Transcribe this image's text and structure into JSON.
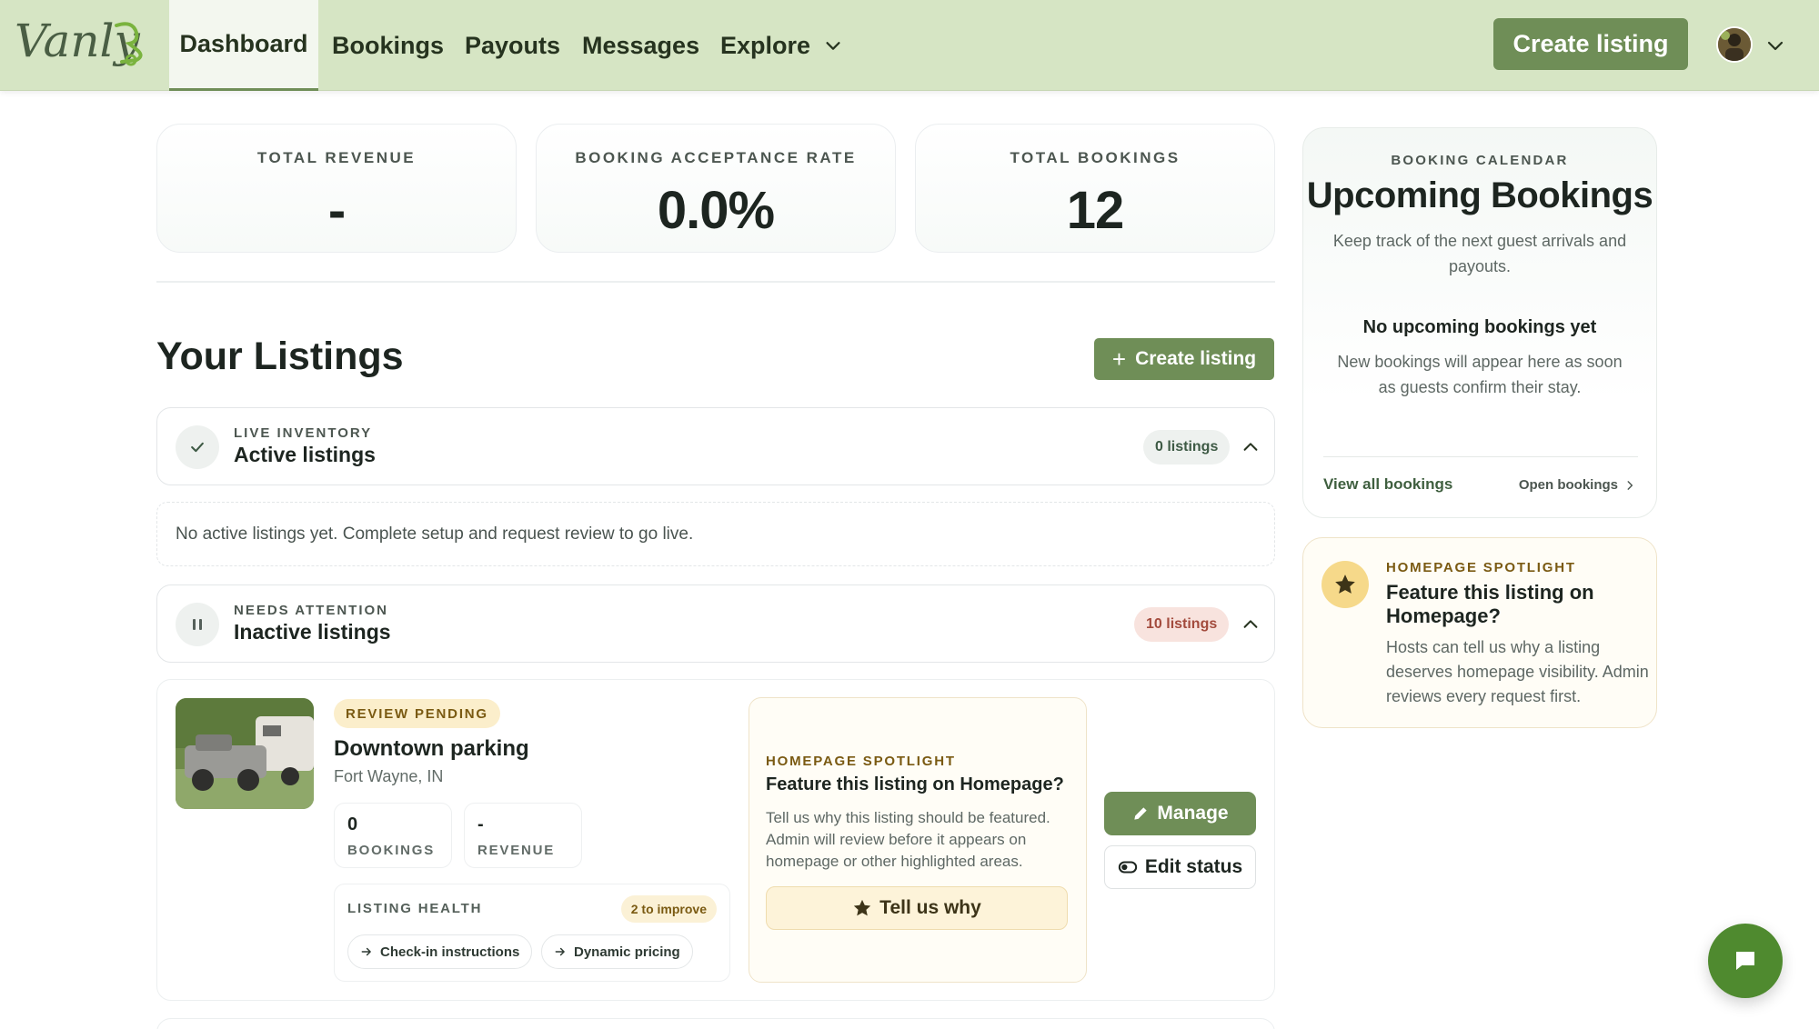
{
  "header": {
    "logo_text": "Vanly",
    "nav": [
      {
        "label": "Dashboard",
        "active": true
      },
      {
        "label": "Bookings",
        "active": false
      },
      {
        "label": "Payouts",
        "active": false
      },
      {
        "label": "Messages",
        "active": false
      },
      {
        "label": "Explore",
        "active": false
      }
    ],
    "create_listing_label": "Create listing",
    "accent_color": "#6f8e57",
    "header_bg": "#d6e5c4"
  },
  "stats": [
    {
      "label": "TOTAL REVENUE",
      "value": "-"
    },
    {
      "label": "BOOKING ACCEPTANCE RATE",
      "value": "0.0%"
    },
    {
      "label": "TOTAL BOOKINGS",
      "value": "12"
    }
  ],
  "listings": {
    "title": "Your Listings",
    "create_label": "Create listing",
    "active_group": {
      "kicker": "LIVE INVENTORY",
      "title": "Active listings",
      "count": "0 listings",
      "icon": "check-icon",
      "empty_text": "No active listings yet. Complete setup and request review to go live."
    },
    "inactive_group": {
      "kicker": "NEEDS ATTENTION",
      "title": "Inactive listings",
      "count": "10 listings",
      "icon": "pause-icon"
    },
    "items": [
      {
        "status": "REVIEW PENDING",
        "title": "Downtown parking",
        "location": "Fort Wayne, IN",
        "bookings_value": "0",
        "bookings_label": "BOOKINGS",
        "revenue_value": "-",
        "revenue_label": "REVENUE",
        "health_label": "LISTING HEALTH",
        "health_badge": "2 to improve",
        "improvements": [
          "Check-in instructions",
          "Dynamic pricing"
        ],
        "spotlight": {
          "kicker": "HOMEPAGE SPOTLIGHT",
          "title": "Feature this listing on Homepage?",
          "description": "Tell us why this listing should be featured. Admin will review before it appears on homepage or other highlighted areas.",
          "button": "Tell us why"
        },
        "manage_label": "Manage",
        "edit_status_label": "Edit status"
      }
    ]
  },
  "calendar": {
    "kicker": "BOOKING CALENDAR",
    "title": "Upcoming Bookings",
    "subtitle": "Keep track of the next guest arrivals and payouts.",
    "empty_title": "No upcoming bookings yet",
    "empty_desc": "New bookings will appear here as soon as guests confirm their stay.",
    "view_all": "View all bookings",
    "open": "Open bookings"
  },
  "spotlight_side": {
    "kicker": "HOMEPAGE SPOTLIGHT",
    "title": "Feature this listing on Homepage?",
    "description": "Hosts can tell us why a listing deserves homepage visibility. Admin reviews every request first."
  }
}
